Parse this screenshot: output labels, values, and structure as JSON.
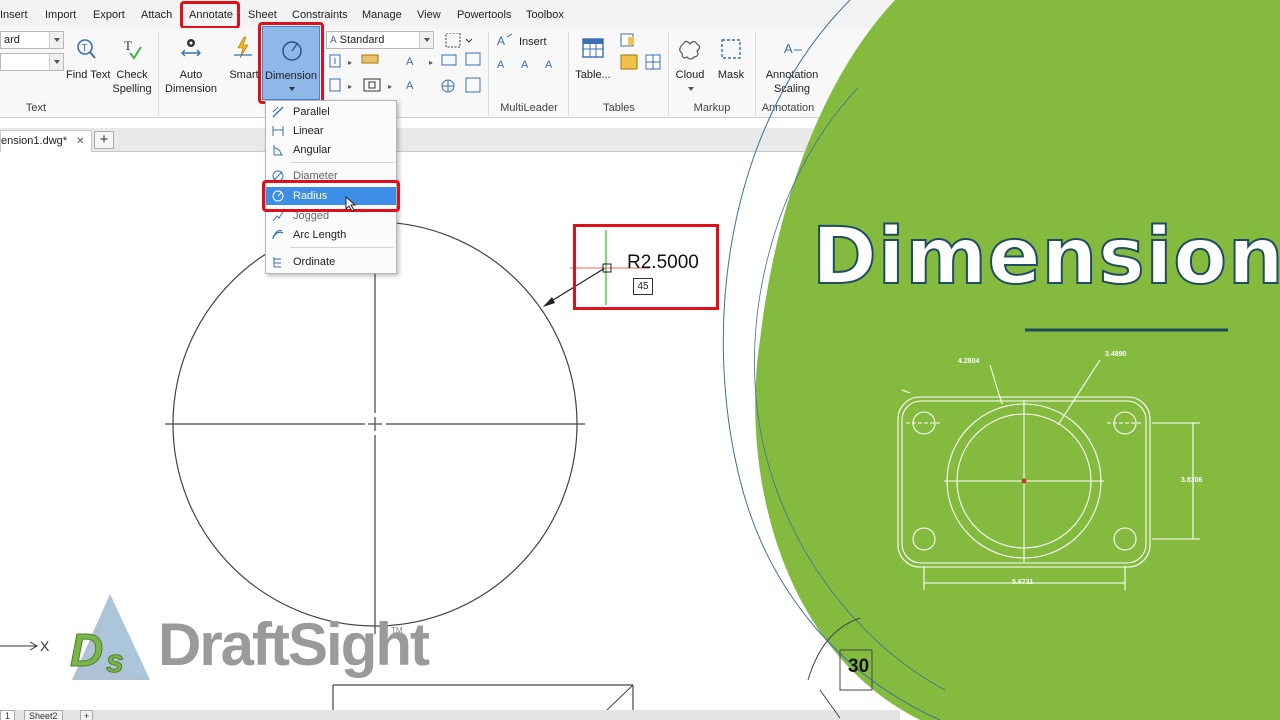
{
  "menubar": {
    "items": [
      "Insert",
      "Import",
      "Export",
      "Attach",
      "Annotate",
      "Sheet",
      "Constraints",
      "Manage",
      "View",
      "Powertools",
      "Toolbox"
    ],
    "active": "Annotate"
  },
  "ribbon": {
    "text_panel": {
      "combo_top": "ard",
      "find_text": "Find Text",
      "check_spelling_1": "Check",
      "check_spelling_2": "Spelling",
      "title": "Text"
    },
    "dimension_panel": {
      "auto_dimension_1": "Auto",
      "auto_dimension_2": "Dimension",
      "smart": "Smart",
      "dimension": "Dimension",
      "style_combo": "Standard"
    },
    "multileader_panel": {
      "insert": "Insert",
      "title": "MultiLeader"
    },
    "tables_panel": {
      "table": "Table...",
      "title": "Tables"
    },
    "markup_panel": {
      "cloud": "Cloud",
      "mask": "Mask",
      "title": "Markup"
    },
    "annotation_panel": {
      "scaling_1": "Annotation",
      "scaling_2": "Scaling",
      "title": "Annotation"
    }
  },
  "dropdown": {
    "items": [
      {
        "label": "Parallel",
        "icon": "parallel-dim-icon"
      },
      {
        "label": "Linear",
        "icon": "linear-dim-icon"
      },
      {
        "label": "Angular",
        "icon": "angular-dim-icon"
      },
      {
        "label": "Diameter",
        "icon": "diameter-dim-icon"
      },
      {
        "label": "Radius",
        "icon": "radius-dim-icon",
        "selected": true
      },
      {
        "label": "Jogged",
        "icon": "jogged-dim-icon"
      },
      {
        "label": "Arc Length",
        "icon": "arc-length-icon"
      },
      {
        "label": "Ordinate",
        "icon": "ordinate-icon"
      }
    ]
  },
  "tabs": {
    "document": "ension1.dwg*",
    "close": "✕",
    "add": "+"
  },
  "drawing": {
    "radius_label": "R2.5000",
    "angle_value": "45",
    "axis_label": "X",
    "corner_number": "30"
  },
  "logo": {
    "text": "DraftSight",
    "tm": "TM",
    "mark": "DS"
  },
  "statusbar": {
    "sheet": "Sheet2"
  },
  "promo": {
    "title": "Dimensions",
    "dim_top_left": "4.2804",
    "dim_top_right": "3.4890",
    "dim_right": "3.8306",
    "dim_bottom": "5.6731"
  },
  "colors": {
    "highlight_red": "#e0101a",
    "selection_blue": "#3d8ee6",
    "promo_green": "#84bb3f",
    "promo_dark": "#1f4c5e"
  }
}
